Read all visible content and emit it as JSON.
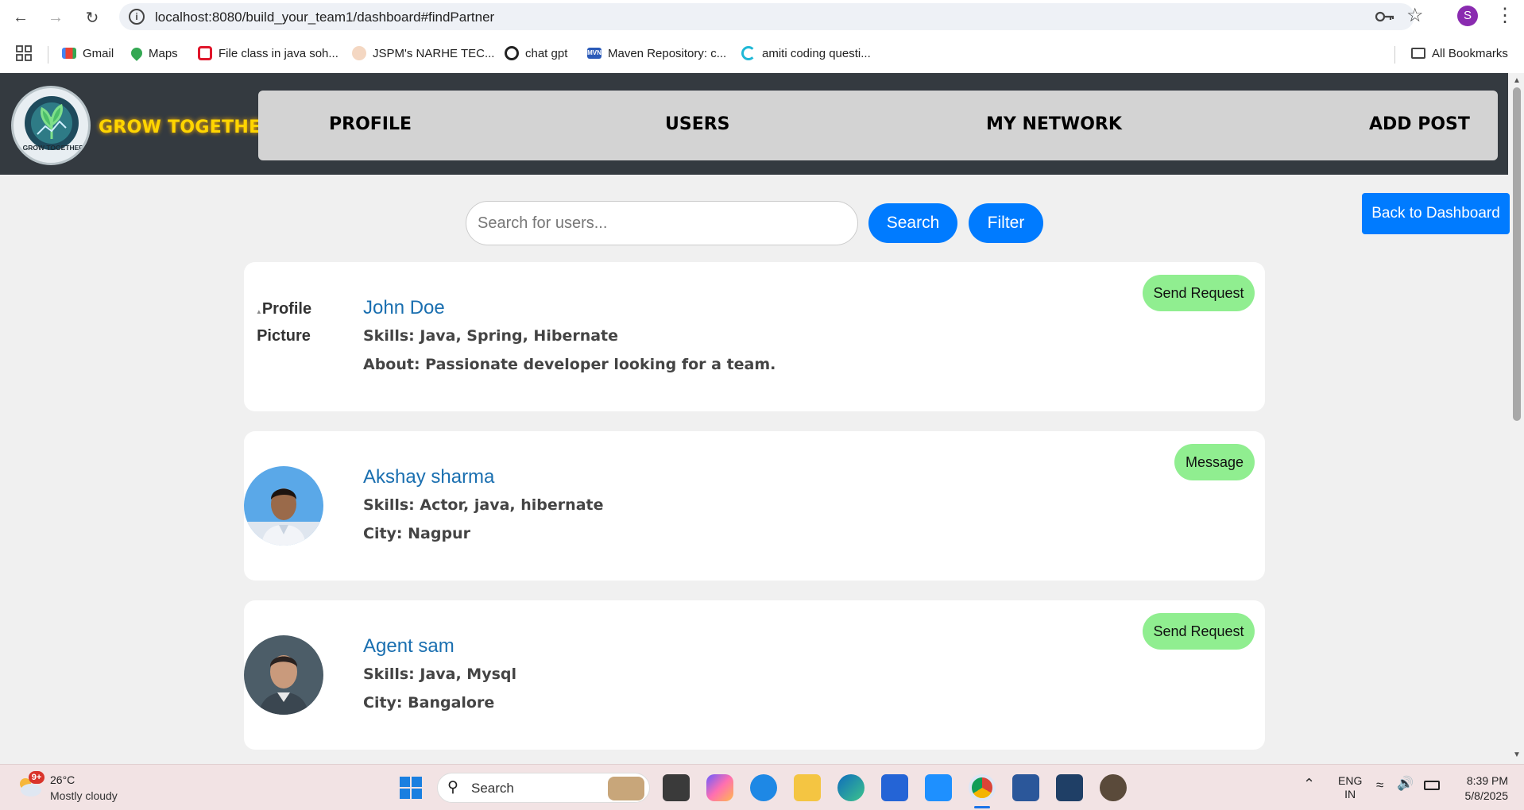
{
  "browser": {
    "url": "localhost:8080/build_your_team1/dashboard#findPartner",
    "profile_initial": "S",
    "bookmarks": [
      {
        "label": "Gmail"
      },
      {
        "label": "Maps"
      },
      {
        "label": "File class in java soh..."
      },
      {
        "label": "JSPM's NARHE TEC..."
      },
      {
        "label": "chat gpt"
      },
      {
        "label": "Maven Repository: c..."
      },
      {
        "label": "amiti coding questi..."
      }
    ],
    "all_bookmarks": "All Bookmarks"
  },
  "header": {
    "brand": "GROW TOGETHER",
    "logo_text": "GROW TOGETHER",
    "nav": [
      "PROFILE",
      "USERS",
      "MY NETWORK",
      "ADD POST"
    ]
  },
  "search": {
    "placeholder": "Search for users...",
    "search_label": "Search",
    "filter_label": "Filter",
    "back_label": "Back to Dashboard"
  },
  "users": [
    {
      "name": "John Doe",
      "line1": "Skills: Java, Spring, Hibernate",
      "line2": "About: Passionate developer looking for a team.",
      "action": "Send Request",
      "pic_alt": "Profile Picture"
    },
    {
      "name": "Akshay sharma",
      "line1": "Skills: Actor, java, hibernate",
      "line2": "City: Nagpur",
      "action": "Message"
    },
    {
      "name": "Agent sam",
      "line1": "Skills: Java, Mysql",
      "line2": "City: Bangalore",
      "action": "Send Request"
    }
  ],
  "taskbar": {
    "weather_badge": "9+",
    "temperature": "26°C",
    "weather": "Mostly cloudy",
    "search_label": "Search",
    "lang_top": "ENG",
    "lang_bottom": "IN",
    "time": "8:39 PM",
    "date": "5/8/2025"
  },
  "colors": {
    "header_bg": "#343a40",
    "brand": "#ffd500",
    "primary": "#007bff",
    "action_green": "#90ee90",
    "name_blue": "#1a6fb0"
  }
}
